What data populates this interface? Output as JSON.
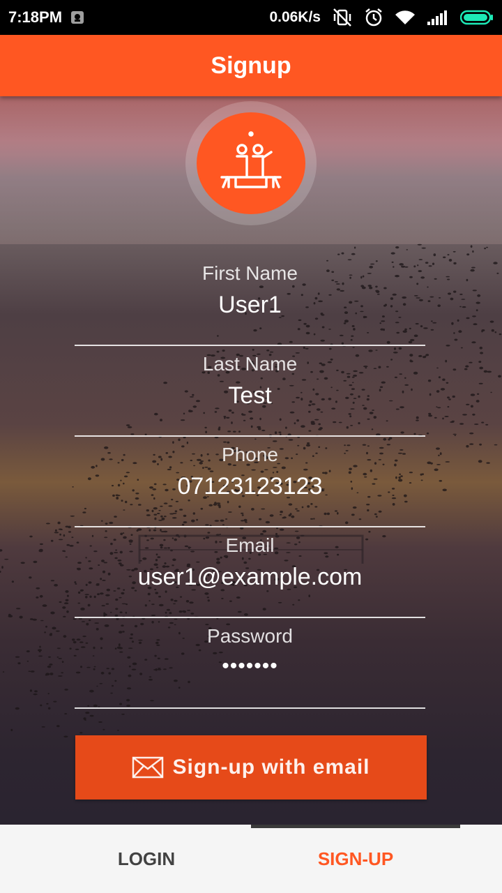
{
  "status_bar": {
    "time": "7:18PM",
    "net_speed": "0.06K/s",
    "icons": [
      "notification-icon",
      "vibrate-off-icon",
      "alarm-icon",
      "wifi-icon",
      "signal-icon",
      "battery-icon"
    ]
  },
  "app_bar": {
    "title": "Signup"
  },
  "logo": {
    "icon": "people-on-bench-icon"
  },
  "form": {
    "fields": [
      {
        "label": "First Name",
        "value": "User1"
      },
      {
        "label": "Last Name",
        "value": "Test"
      },
      {
        "label": "Phone",
        "value": "07123123123"
      },
      {
        "label": "Email",
        "value": "user1@example.com"
      },
      {
        "label": "Password",
        "value": "•••••••"
      }
    ],
    "submit": {
      "label": "Sign-up with email",
      "icon": "mail-icon"
    }
  },
  "tabs": [
    {
      "label": "LOGIN",
      "selected": false
    },
    {
      "label": "SIGN-UP",
      "selected": true
    }
  ],
  "colors": {
    "primary": "#ff5722",
    "button": "#e64a19",
    "tab_bar": "#f5f5f5",
    "tab_inactive": "#424242"
  }
}
